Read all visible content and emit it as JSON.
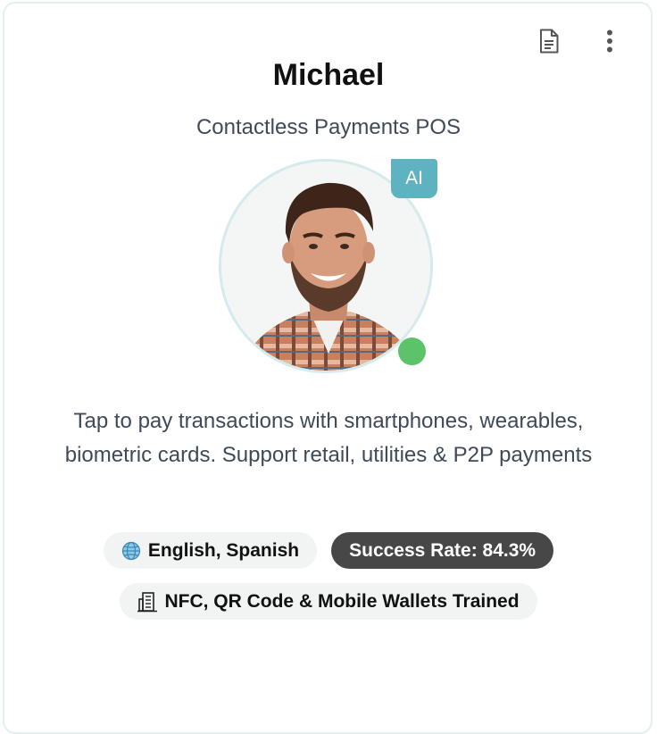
{
  "agent": {
    "name": "Michael",
    "title": "Contactless Payments POS",
    "badge": "AI",
    "description": "Tap to pay transactions with smartphones, wearables, biometric cards. Support retail, utilities & P2P payments",
    "languages": "English, Spanish",
    "success_rate": "Success Rate: 84.3%",
    "training": "NFC, QR Code & Mobile Wallets Trained",
    "status": "online"
  },
  "icons": {
    "document": "document-icon",
    "more": "more-vertical-icon",
    "globe": "globe-icon",
    "building": "building-icon"
  },
  "colors": {
    "badge": "#5fb3c0",
    "status_online": "#5cc36b",
    "dark_chip": "#474747",
    "light_chip": "#f2f3f3",
    "ring": "#d5eaec"
  }
}
